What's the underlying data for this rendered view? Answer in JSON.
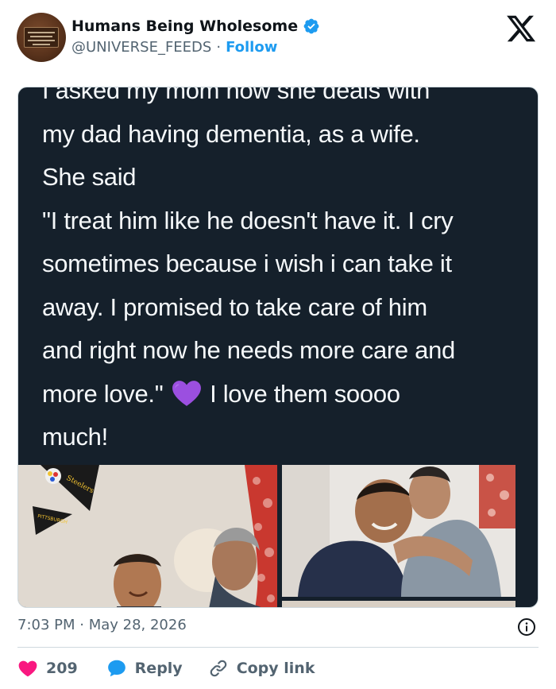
{
  "header": {
    "display_name": "Humans Being Wholesome",
    "handle": "@UNIVERSE_FEEDS",
    "separator": "·",
    "follow_label": "Follow",
    "verified_color": "#1d9bf0"
  },
  "media": {
    "text_lines": [
      "I asked my mom how she deals with",
      "my dad having dementia, as a wife.",
      "She said",
      "\"I treat him like he doesn't have it. I cry",
      "sometimes because i wish i can take it",
      "away. I promised to take care of him",
      "and right now he needs more care and"
    ],
    "text_last_before_emoji": "more love.\"",
    "emoji": "purple-heart",
    "text_last_after_emoji": "I love them soooo",
    "text_final": "much!"
  },
  "footer": {
    "timestamp": "7:03 PM · May 28, 2026",
    "like_count": "209",
    "reply_label": "Reply",
    "copy_link_label": "Copy link",
    "like_color": "#f91880",
    "reply_color": "#1d9bf0"
  },
  "icons": [
    "verified-badge-icon",
    "x-logo-icon",
    "info-icon",
    "heart-icon",
    "reply-bubble-icon",
    "link-icon"
  ]
}
